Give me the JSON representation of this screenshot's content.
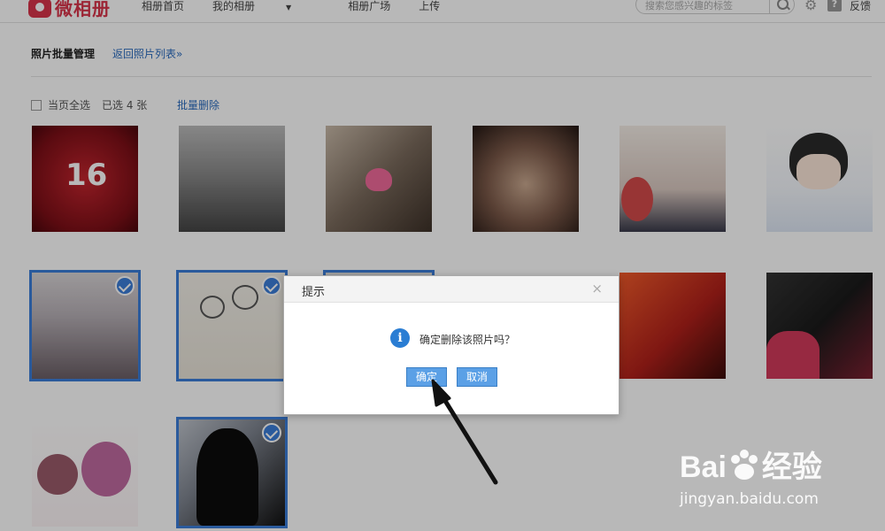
{
  "header": {
    "logo_text": "微相册",
    "nav": [
      {
        "label": "相册首页"
      },
      {
        "label": "我的相册",
        "has_caret": true
      },
      {
        "label": "相册广场"
      },
      {
        "label": "上传"
      }
    ],
    "search_placeholder": "搜索您感兴趣的标签",
    "help_label": "?",
    "feedback_label": "反馈"
  },
  "manage": {
    "title": "照片批量管理",
    "back_link": "返回照片列表»",
    "select_all_label": "当页全选",
    "selected_count": "已选 4 张",
    "batch_delete": "批量删除"
  },
  "photos": [
    {
      "id": "p1",
      "selected": false,
      "caption": "16"
    },
    {
      "id": "p2",
      "selected": false
    },
    {
      "id": "p3",
      "selected": false
    },
    {
      "id": "p4",
      "selected": false
    },
    {
      "id": "p5",
      "selected": false
    },
    {
      "id": "p6",
      "selected": false
    },
    {
      "id": "p7",
      "selected": true
    },
    {
      "id": "p8",
      "selected": true
    },
    {
      "id": "p9",
      "selected": false
    },
    {
      "id": "p10",
      "selected": false
    },
    {
      "id": "p11",
      "selected": false
    },
    {
      "id": "p12",
      "selected": true
    }
  ],
  "dialog": {
    "title": "提示",
    "close": "×",
    "info_icon": "i",
    "message": "确定删除该照片吗？",
    "ok_label": "确定",
    "cancel_label": "取消"
  },
  "watermark": {
    "logo": "Bai",
    "logo_tail": "经验",
    "url": "jingyan.baidu.com"
  },
  "colors": {
    "accent": "#3b7dd8",
    "link": "#2b6cbf",
    "brand": "#d8344a",
    "button": "#5ba0e6"
  }
}
